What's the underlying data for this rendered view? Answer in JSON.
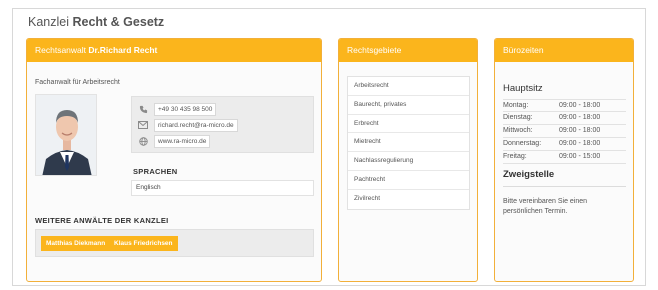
{
  "brand": {
    "prefix": "Kanzlei",
    "name": "Recht & Gesetz"
  },
  "lawyer_panel": {
    "header_prefix": "Rechtsanwalt",
    "header_name": "Dr.Richard Recht",
    "subtitle": "Fachanwalt für Arbeitsrecht",
    "contact": {
      "phone": "+49 30 435 98 500",
      "email": "richard.recht@ra-micro.de",
      "web": "www.ra-micro.de"
    },
    "languages_title": "SPRACHEN",
    "language": "Englisch",
    "colleagues_title": "WEITERE ANWÄLTE DER KANZLEI",
    "colleagues": [
      "Matthias Diekmann",
      "Klaus Friedrichsen"
    ]
  },
  "areas_panel": {
    "header": "Rechtsgebiete",
    "items": [
      "Arbeitsrecht",
      "Baurecht, privates",
      "Erbrecht",
      "Mietrecht",
      "Nachlassregulierung",
      "Pachtrecht",
      "Zivilrecht"
    ]
  },
  "hours_panel": {
    "header": "Bürozeiten",
    "main_office_title": "Hauptsitz",
    "hours": [
      {
        "day": "Montag:",
        "time": "09:00 - 18:00"
      },
      {
        "day": "Dienstag:",
        "time": "09:00 - 18:00"
      },
      {
        "day": "Mittwoch:",
        "time": "09:00 - 18:00"
      },
      {
        "day": "Donnerstag:",
        "time": "09:00 - 18:00"
      },
      {
        "day": "Freitag:",
        "time": "09:00 - 15:00"
      }
    ],
    "branch_title": "Zweigstelle",
    "branch_note": "Bitte vereinbaren Sie einen persönlichen Termin."
  },
  "colors": {
    "accent": "#fbb51c",
    "panel_border": "#f2b03a"
  }
}
